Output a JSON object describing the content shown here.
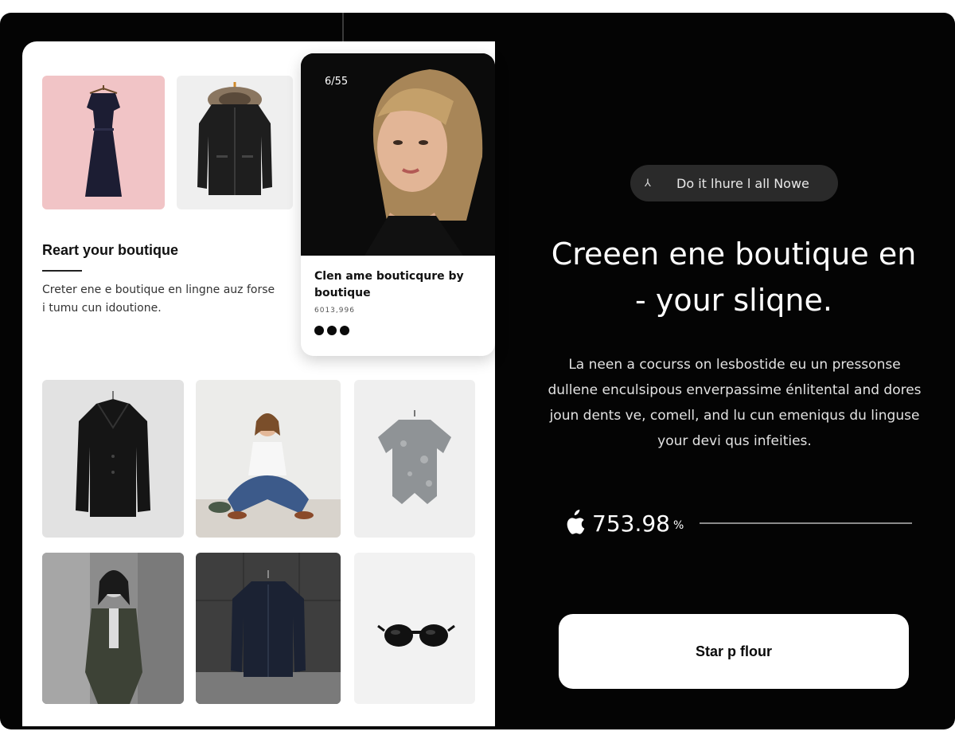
{
  "card": {
    "counter": "6/55",
    "title": "Clen ame bouticqure by boutique",
    "subtitle": "6013,996"
  },
  "intro": {
    "title": "Reart your boutique",
    "description": "Creter ene e boutique en lingne auz forse i tumu cun idoutione."
  },
  "hero": {
    "pill_text": "Do it lhure  l  all Nowe",
    "pill_icon": "arrow-mark-icon",
    "headline": "Creeen ene boutique en - your sliqne.",
    "body": "La neen a cocurss on lesbostide eu un pressonse dullene enculsipous enverpassime énlitental and dores joun dents ve, comell, and lu cun emeniqus du linguse your devi qus infeities.",
    "price_value": "753.98",
    "price_unit": "%",
    "price_icon": "apple-icon",
    "cta_label": "Star p flour"
  },
  "colors": {
    "background": "#040404",
    "panel": "#ffffff",
    "pill": "#2a2a2a",
    "accent_pink": "#f1c4c6"
  }
}
